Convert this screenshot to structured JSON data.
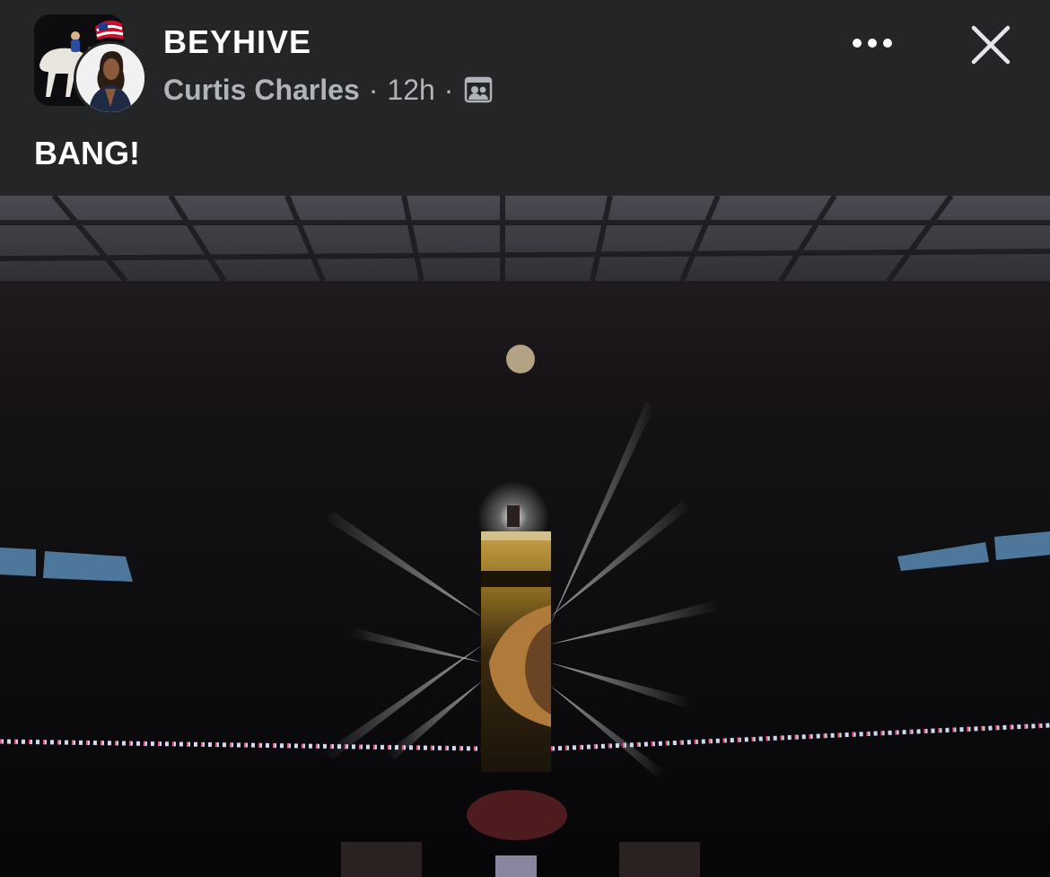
{
  "post": {
    "group_name": "BEYHIVE",
    "author": "Curtis Charles",
    "separator": "·",
    "time": "12h",
    "audience_icon": "group-audience-icon",
    "text": "BANG!"
  },
  "actions": {
    "more_icon": "more-horizontal-icon",
    "close_icon": "close-icon"
  },
  "photo": {
    "subject": "Dark stadium with a tall lit screen tower in the center and light beams"
  },
  "colors": {
    "background": "#242526",
    "primary_text": "#ffffff",
    "secondary_text": "#b0b3b8"
  }
}
